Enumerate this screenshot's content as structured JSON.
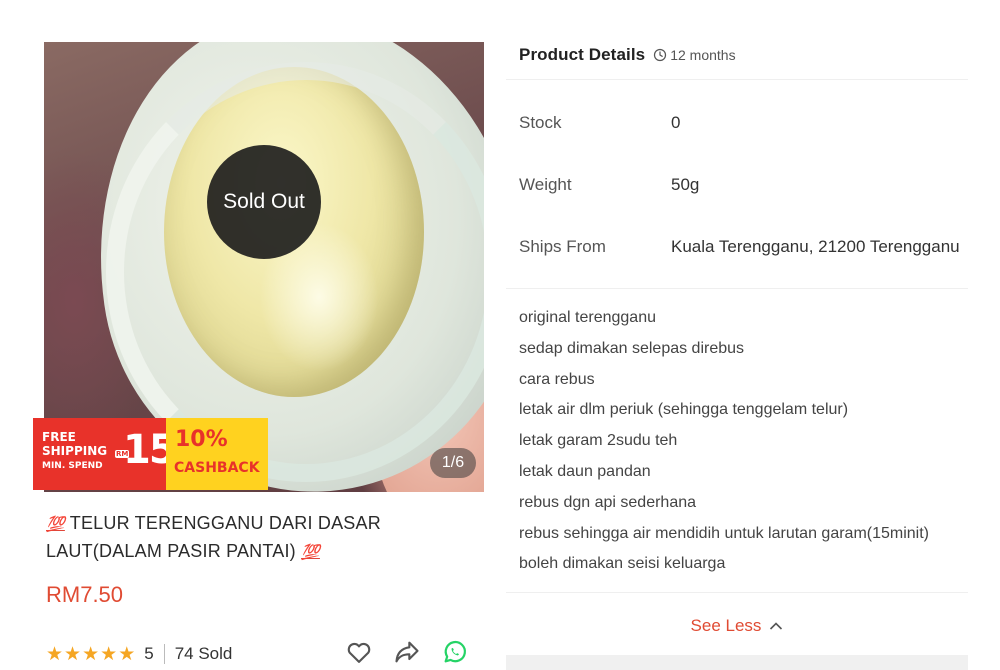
{
  "image": {
    "sold_out_label": "Sold Out",
    "counter": "1/6"
  },
  "promo": {
    "free_line1": "FREE",
    "free_line2": "SHIPPING",
    "free_line3": "MIN. SPEND",
    "currency": "RM",
    "amount": "15",
    "cashback_pct": "10%",
    "cashback_label": "CASHBACK"
  },
  "product": {
    "title_prefix_emoji": "💯",
    "title": "TELUR TERENGGANU DARI DASAR LAUT(DALAM PASIR PANTAI)",
    "title_suffix_emoji": "💯",
    "price": "RM7.50",
    "rating": "5",
    "stars_filled": 5,
    "sold": "74 Sold"
  },
  "actions": {
    "icons": [
      "heart-icon",
      "share-icon",
      "whatsapp-icon"
    ],
    "colors": {
      "whatsapp": "#25d366",
      "icon_stroke": "#555555"
    }
  },
  "details": {
    "header": "Product Details",
    "shelf_life": "12 months",
    "specs": [
      {
        "label": "Stock",
        "value": "0"
      },
      {
        "label": "Weight",
        "value": "50g"
      },
      {
        "label": "Ships From",
        "value": "Kuala Terengganu, 21200 Terengganu"
      }
    ],
    "description": [
      "original terengganu",
      "sedap dimakan selepas direbus",
      "cara rebus",
      "letak air dlm periuk (sehingga tenggelam telur)",
      "letak garam 2sudu teh",
      "letak daun pandan",
      "rebus dgn api sederhana",
      "rebus sehingga air mendidih untuk larutan garam(15minit)",
      "boleh dimakan seisi keluarga"
    ],
    "see_less": "See Less"
  },
  "colors": {
    "accent": "#e04b33",
    "star": "#f5a623",
    "promo_red": "#e8322a",
    "promo_yellow": "#ffd21f"
  }
}
